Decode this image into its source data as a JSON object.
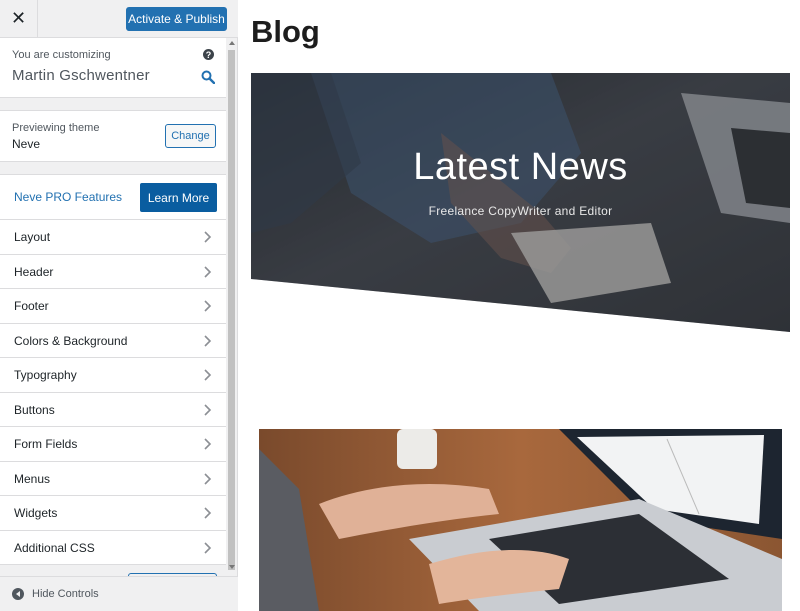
{
  "topbar": {
    "close_symbol": "✕",
    "publish_label": "Activate & Publish"
  },
  "info": {
    "customizing_label": "You are customizing",
    "site_name": "Martin Gschwentner",
    "help_symbol": "?"
  },
  "theme": {
    "previewing_label": "Previewing theme",
    "name": "Neve",
    "change_label": "Change"
  },
  "pro": {
    "label": "Neve PRO Features",
    "button_label": "Learn More"
  },
  "menu": {
    "items": [
      {
        "label": "Layout"
      },
      {
        "label": "Header"
      },
      {
        "label": "Footer"
      },
      {
        "label": "Colors & Background"
      },
      {
        "label": "Typography"
      },
      {
        "label": "Buttons"
      },
      {
        "label": "Form Fields"
      },
      {
        "label": "Menus"
      },
      {
        "label": "Widgets"
      },
      {
        "label": "Additional CSS"
      }
    ]
  },
  "footer": {
    "hide_label": "Hide Controls"
  },
  "preview": {
    "page_title": "Blog",
    "hero_title": "Latest News",
    "hero_subtitle": "Freelance CopyWriter and Editor"
  },
  "colors": {
    "accent": "#2271b1",
    "learn_more_bg": "#0a5da0",
    "sidebar_bg": "#f0f0f1"
  },
  "icons": {
    "close": "close-icon",
    "help": "help-icon",
    "search": "search-icon",
    "chevron": "chevron-right-icon",
    "hide": "collapse-icon"
  }
}
